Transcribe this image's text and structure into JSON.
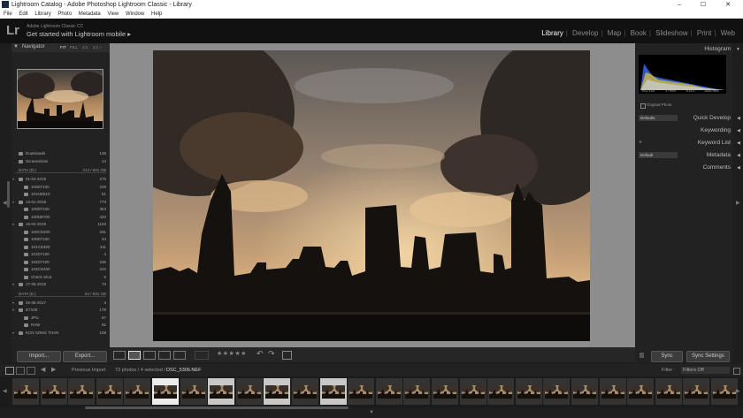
{
  "window": {
    "title": "Lightroom Catalog - Adobe Photoshop Lightroom Classic - Library",
    "controls": "–  ☐  ✕"
  },
  "menu": [
    "File",
    "Edit",
    "Library",
    "Photo",
    "Metadata",
    "View",
    "Window",
    "Help"
  ],
  "identity": {
    "logo": "Lr",
    "small": "Adobe Lightroom Classic CC",
    "main": "Get started with Lightroom mobile  ▸"
  },
  "modules": [
    "Library",
    "Develop",
    "Map",
    "Book",
    "Slideshow",
    "Print",
    "Web"
  ],
  "navigator": {
    "title": "Navigator",
    "zoom": [
      "FIT",
      "FILL",
      "1:1",
      "3:1 ÷"
    ]
  },
  "folders_top": [
    {
      "name": "Downloads",
      "count": "135"
    },
    {
      "name": "Screenshots",
      "count": "14"
    }
  ],
  "volumes": [
    {
      "name": "DATA (D:)",
      "space": "214 / 931 GB"
    },
    {
      "name": "DATA (E:)",
      "space": "64 / 931 GB"
    }
  ],
  "folders_d": [
    {
      "name": "01-02-2019",
      "count": "276",
      "level": 1
    },
    {
      "name": "100D7100",
      "count": "228",
      "level": 2
    },
    {
      "name": "101ND610",
      "count": "51",
      "level": 2
    },
    {
      "name": "13-01-2019",
      "count": "773",
      "level": 1
    },
    {
      "name": "100D7100",
      "count": "353",
      "level": 2
    },
    {
      "name": "100ND700",
      "count": "420",
      "level": 2
    },
    {
      "name": "15-04-2019",
      "count": "1163",
      "level": 1
    },
    {
      "name": "100CD400",
      "count": "331",
      "level": 2
    },
    {
      "name": "100D7100",
      "count": "34",
      "level": 2
    },
    {
      "name": "101CD400",
      "count": "311",
      "level": 2
    },
    {
      "name": "101D7100",
      "count": "4",
      "level": 2
    },
    {
      "name": "102D7100",
      "count": "236",
      "level": 2
    },
    {
      "name": "103CD400",
      "count": "242",
      "level": 2
    },
    {
      "name": "Check Shot",
      "count": "5",
      "level": 2
    },
    {
      "name": "17-05-2019",
      "count": "73",
      "level": 1
    }
  ],
  "folders_e": [
    {
      "name": "26-06-2017",
      "count": "3",
      "level": 1
    },
    {
      "name": "D7100",
      "count": "179",
      "level": 1
    },
    {
      "name": "JPG",
      "count": "87",
      "level": 2
    },
    {
      "name": "RAW",
      "count": "92",
      "level": 2
    },
    {
      "name": "KCN SONG THAN",
      "count": "108",
      "level": 1
    }
  ],
  "left_buttons": {
    "import": "Import...",
    "export": "Export..."
  },
  "right_panel": {
    "histogram": "Histogram",
    "histo_info": [
      "ISO 100",
      "17 mm",
      "f/13.0",
      "1/640 sec"
    ],
    "original_photo": "Original Photo",
    "preset_default": "Defaults",
    "quick_develop": "Quick Develop",
    "keywording": "Keywording",
    "keyword_list": "Keyword List",
    "metadata_preset": "Default",
    "metadata": "Metadata",
    "comments": "Comments"
  },
  "right_buttons": {
    "sync": "Sync",
    "sync_settings": "Sync Settings"
  },
  "toolbar": {
    "stars": "★★★★★"
  },
  "filmstrip_bar": {
    "previous_import": "Previous Import",
    "info": "73 photos / 4 selected /",
    "filename": "DSC_5306.NEF",
    "filter_label": "Filter :",
    "filter_value": "Filters Off"
  },
  "filmstrip": {
    "count": 26,
    "selected": [
      5,
      7,
      9,
      11
    ],
    "current": 5
  },
  "colors": {
    "accent": "#ffffff",
    "panel": "#222222",
    "center_bg": "#8d8d8d",
    "histo_blue": "#3a63d8",
    "histo_yellow": "#d8c23a"
  }
}
